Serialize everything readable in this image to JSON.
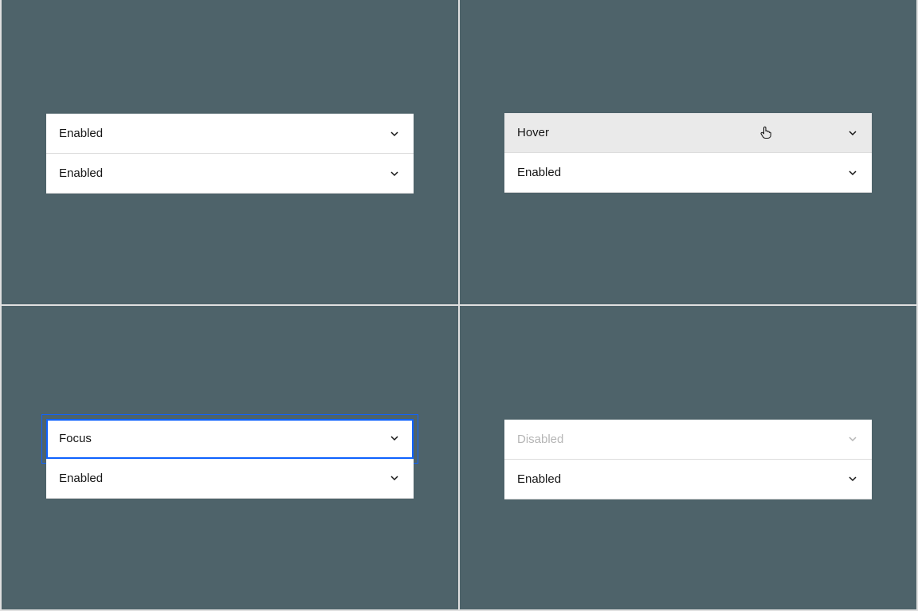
{
  "panes": {
    "top_left": {
      "items": [
        {
          "label": "Enabled",
          "state": "enabled"
        },
        {
          "label": "Enabled",
          "state": "enabled"
        }
      ]
    },
    "top_right": {
      "items": [
        {
          "label": "Hover",
          "state": "hover",
          "cursor": true
        },
        {
          "label": "Enabled",
          "state": "enabled"
        }
      ]
    },
    "bottom_left": {
      "items": [
        {
          "label": "Focus",
          "state": "focus"
        },
        {
          "label": "Enabled",
          "state": "enabled"
        }
      ]
    },
    "bottom_right": {
      "items": [
        {
          "label": "Disabled",
          "state": "disabled"
        },
        {
          "label": "Enabled",
          "state": "enabled"
        }
      ]
    }
  }
}
